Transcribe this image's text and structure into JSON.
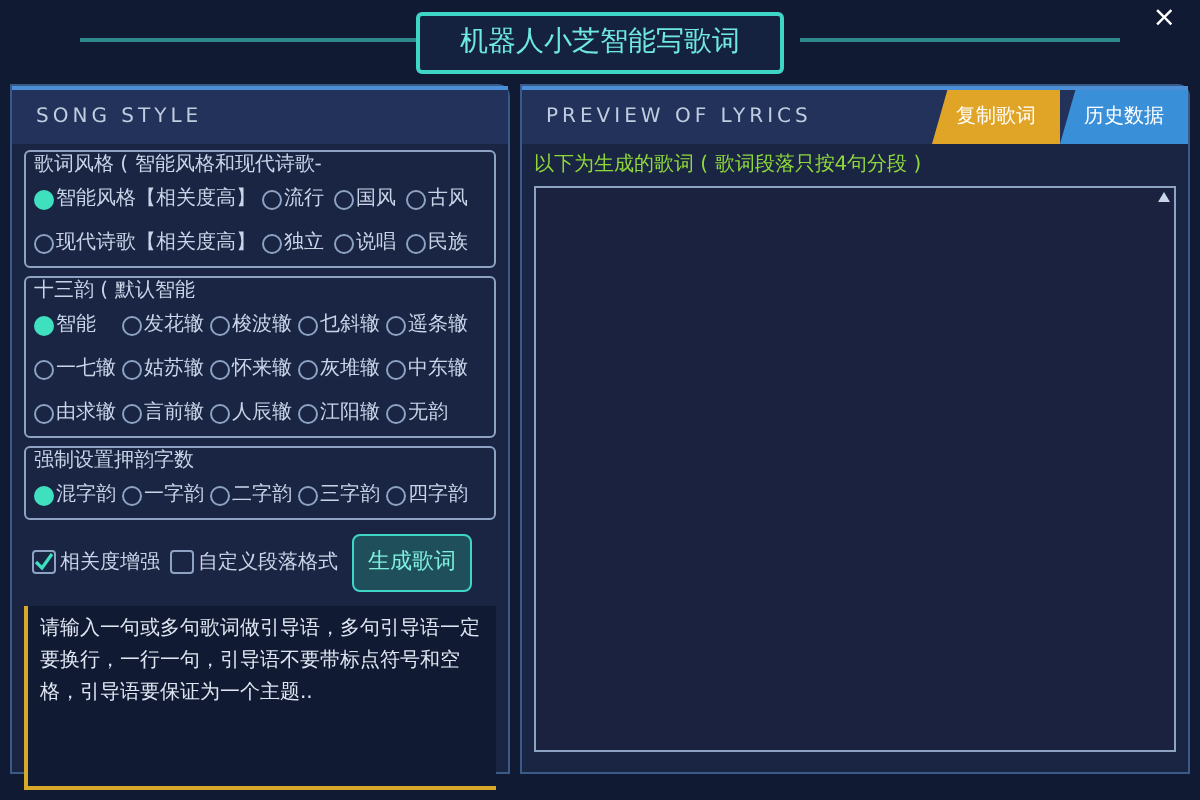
{
  "window": {
    "title": "机器人小芝智能写歌词",
    "close": "×"
  },
  "left_panel": {
    "heading": "SONG STYLE",
    "groups": [
      {
        "legend": "歌词风格 ( 智能风格和现代诗歌-",
        "options": [
          {
            "label": "智能风格【相关度高】",
            "selected": true
          },
          {
            "label": "流行",
            "selected": false
          },
          {
            "label": "国风",
            "selected": false
          },
          {
            "label": "古风",
            "selected": false
          },
          {
            "label": "现代诗歌【相关度高】",
            "selected": false
          },
          {
            "label": "独立",
            "selected": false
          },
          {
            "label": "说唱",
            "selected": false
          },
          {
            "label": "民族",
            "selected": false
          }
        ]
      },
      {
        "legend": "十三韵 ( 默认智能",
        "options": [
          {
            "label": "智能",
            "selected": true
          },
          {
            "label": "发花辙",
            "selected": false
          },
          {
            "label": "梭波辙",
            "selected": false
          },
          {
            "label": "乜斜辙",
            "selected": false
          },
          {
            "label": "遥条辙",
            "selected": false
          },
          {
            "label": "一七辙",
            "selected": false
          },
          {
            "label": "姑苏辙",
            "selected": false
          },
          {
            "label": "怀来辙",
            "selected": false
          },
          {
            "label": "灰堆辙",
            "selected": false
          },
          {
            "label": "中东辙",
            "selected": false
          },
          {
            "label": "由求辙",
            "selected": false
          },
          {
            "label": "言前辙",
            "selected": false
          },
          {
            "label": "人辰辙",
            "selected": false
          },
          {
            "label": "江阳辙",
            "selected": false
          },
          {
            "label": "无韵",
            "selected": false
          }
        ]
      },
      {
        "legend": "强制设置押韵字数",
        "options": [
          {
            "label": "混字韵",
            "selected": true
          },
          {
            "label": "一字韵",
            "selected": false
          },
          {
            "label": "二字韵",
            "selected": false
          },
          {
            "label": "三字韵",
            "selected": false
          },
          {
            "label": "四字韵",
            "selected": false
          }
        ]
      }
    ],
    "checkboxes": [
      {
        "label": "相关度增强",
        "checked": true
      },
      {
        "label": "自定义段落格式",
        "checked": false
      }
    ],
    "generate_button": "生成歌词",
    "prompt_field": {
      "placeholder": "请输入一句或多句歌词做引导语，多句引导语一定要换行，一行一句，引导语不要带标点符号和空格，引导语要保证为一个主题.."
    }
  },
  "right_panel": {
    "heading": "PREVIEW OF LYRICS",
    "tabs": [
      {
        "label": "复制歌词",
        "color": "#e0a526"
      },
      {
        "label": "历史数据",
        "color": "#3a8fd9"
      }
    ],
    "note": "以下为生成的歌词 ( 歌词段落只按4句分段 )"
  }
}
